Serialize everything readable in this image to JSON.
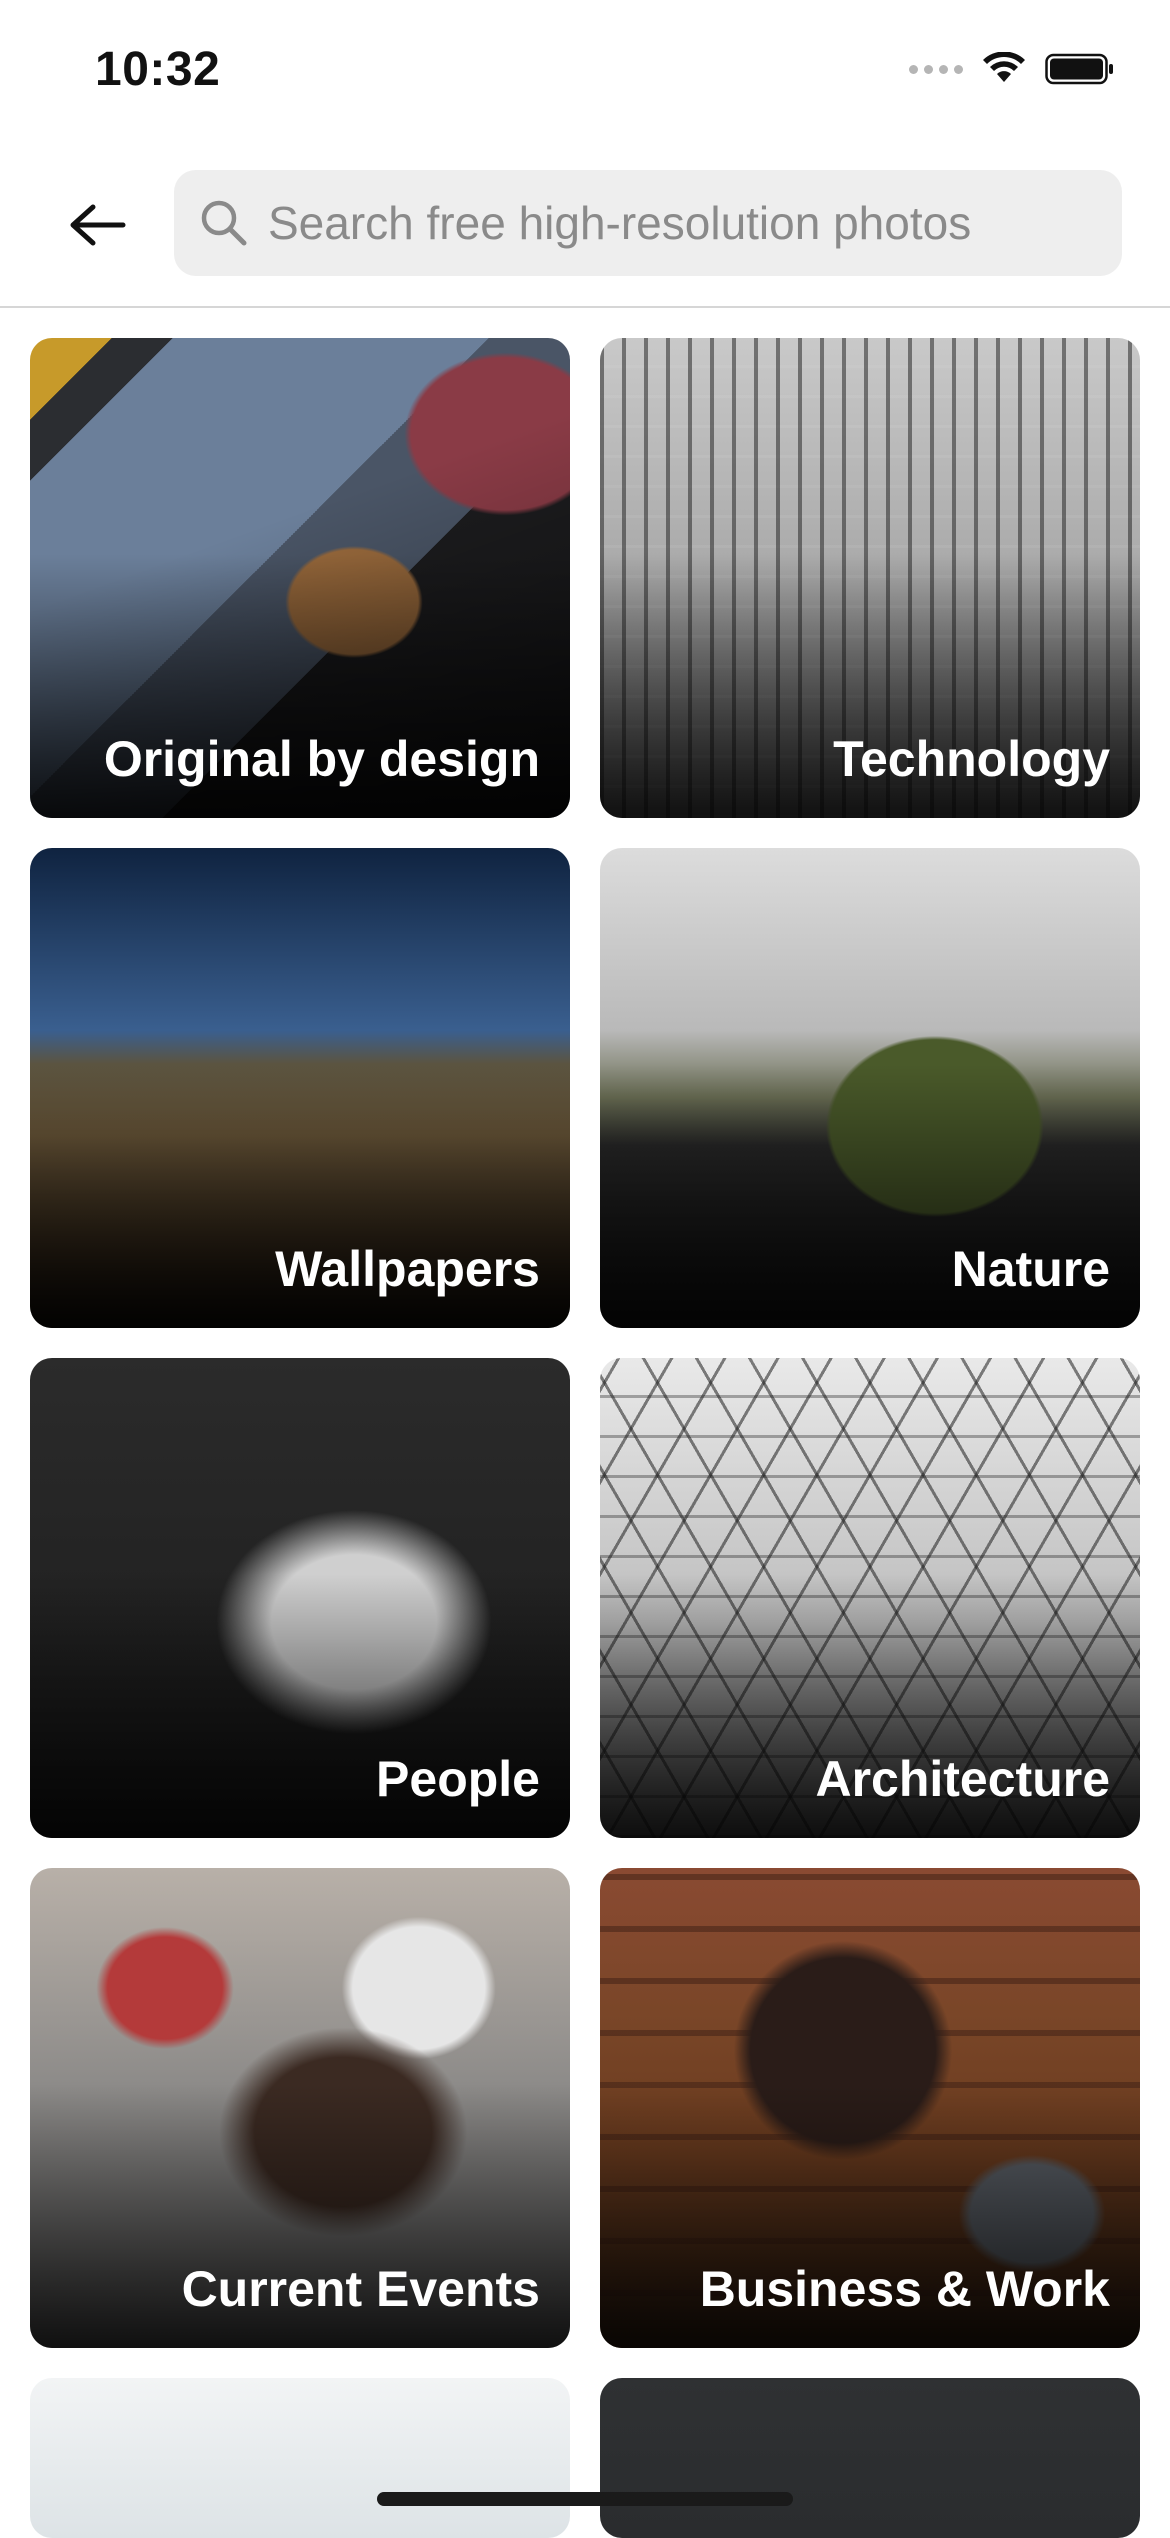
{
  "status_bar": {
    "time": "10:32"
  },
  "header": {
    "back_icon": "arrow-left-icon",
    "search": {
      "placeholder": "Search free high-resolution photos",
      "value": "",
      "icon": "search-icon"
    }
  },
  "topics": [
    {
      "label": "Original by design"
    },
    {
      "label": "Technology"
    },
    {
      "label": "Wallpapers"
    },
    {
      "label": "Nature"
    },
    {
      "label": "People"
    },
    {
      "label": "Architecture"
    },
    {
      "label": "Current Events"
    },
    {
      "label": "Business & Work"
    }
  ],
  "colors": {
    "search_bg": "#eeeeee",
    "placeholder": "#8a8a8a",
    "divider": "#d6d6d6",
    "tile_label": "#ffffff"
  }
}
